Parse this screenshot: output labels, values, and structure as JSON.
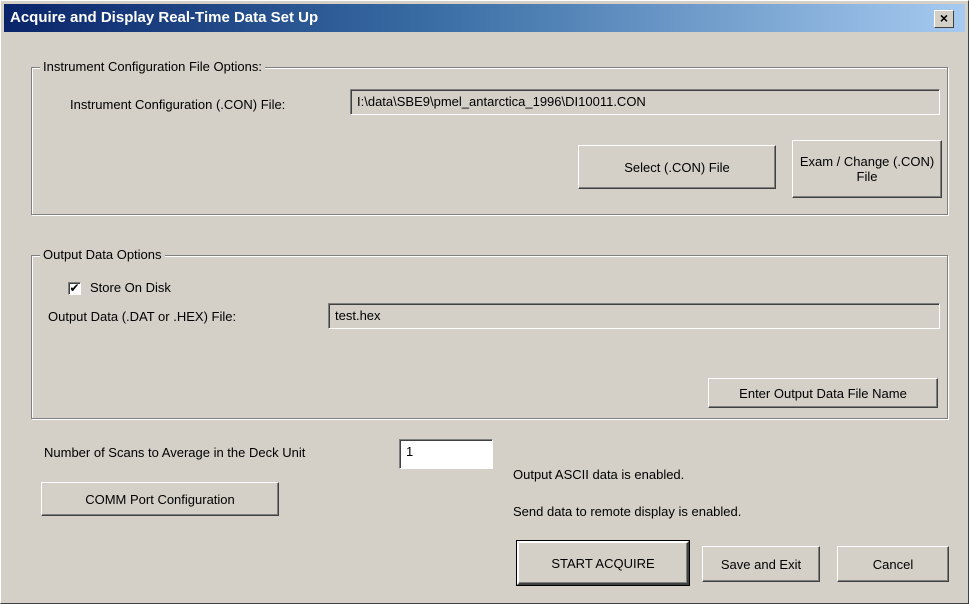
{
  "window": {
    "title": "Acquire and Display Real-Time Data Set Up",
    "close_glyph": "×"
  },
  "instrument_group": {
    "legend": "Instrument Configuration File Options:",
    "con_file_label": "Instrument Configuration (.CON) File:",
    "con_file_value": "I:\\data\\SBE9\\pmel_antarctica_1996\\DI10011.CON",
    "select_button": "Select (.CON) File",
    "examine_button": "Exam / Change (.CON) File"
  },
  "output_group": {
    "legend": "Output Data Options",
    "store_on_disk_label": "Store On Disk",
    "store_on_disk_checked": true,
    "check_glyph": "✔",
    "output_file_label": "Output Data (.DAT or .HEX) File:",
    "output_file_value": "test.hex",
    "enter_name_button": "Enter Output Data File Name"
  },
  "scans": {
    "label": "Number of Scans to Average in the Deck Unit",
    "value": "1"
  },
  "comm_button": "COMM Port Configuration",
  "status": {
    "ascii": "Output ASCII data is enabled.",
    "remote": "Send data to remote display is enabled."
  },
  "actions": {
    "start": "START ACQUIRE",
    "save_exit": "Save and Exit",
    "cancel": "Cancel"
  }
}
